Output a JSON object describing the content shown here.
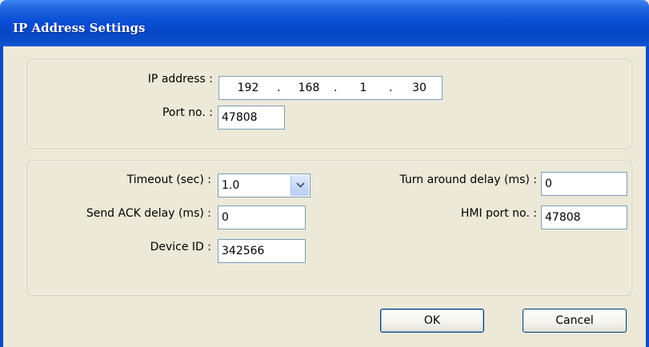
{
  "dialog": {
    "title": "IP Address Settings"
  },
  "connection": {
    "ip_label": "IP address :",
    "ip": [
      "192",
      "168",
      "1",
      "30"
    ],
    "ip_separator": ".",
    "port_label": "Port no. :",
    "port_value": "47808"
  },
  "options": {
    "timeout_label": "Timeout (sec) :",
    "timeout_value": "1.0",
    "send_ack_label": "Send ACK delay (ms) :",
    "send_ack_value": "0",
    "device_id_label": "Device ID :",
    "device_id_value": "342566",
    "turnaround_label": "Turn around delay (ms) :",
    "turnaround_value": "0",
    "hmi_port_label": "HMI port no. :",
    "hmi_port_value": "47808"
  },
  "buttons": {
    "ok_label": "OK",
    "cancel_label": "Cancel"
  },
  "icons": {
    "dropdown": "chevron-down-icon"
  }
}
